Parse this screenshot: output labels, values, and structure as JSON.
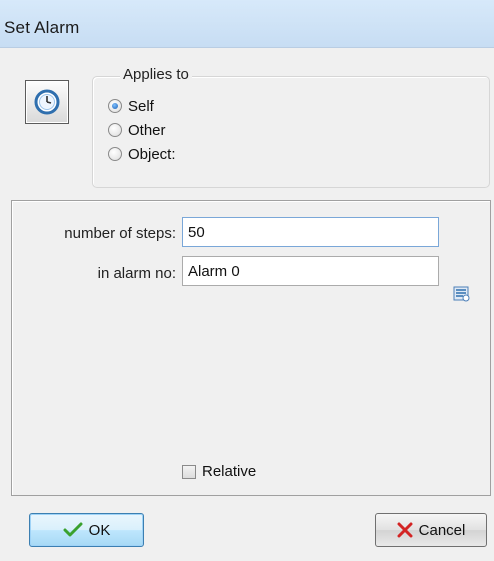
{
  "window": {
    "title": "Set Alarm"
  },
  "applies_to": {
    "legend": "Applies to",
    "options": [
      {
        "label": "Self",
        "checked": true
      },
      {
        "label": "Other",
        "checked": false
      },
      {
        "label": "Object:",
        "checked": false
      }
    ]
  },
  "fields": {
    "steps": {
      "label": "number of steps:",
      "value": "50"
    },
    "alarm": {
      "label": "in alarm no:",
      "value": "Alarm 0"
    }
  },
  "relative": {
    "label": "Relative",
    "checked": false
  },
  "buttons": {
    "ok": "OK",
    "cancel": "Cancel"
  },
  "icons": {
    "action": "clock-icon",
    "alarm_menu": "list-menu-icon",
    "ok": "checkmark-icon",
    "cancel": "x-icon"
  },
  "colors": {
    "titlebar": "#c7ddf3",
    "ok_check": "#3aa12f",
    "cancel_x": "#d32424",
    "focus_border": "#7aa7d8"
  }
}
